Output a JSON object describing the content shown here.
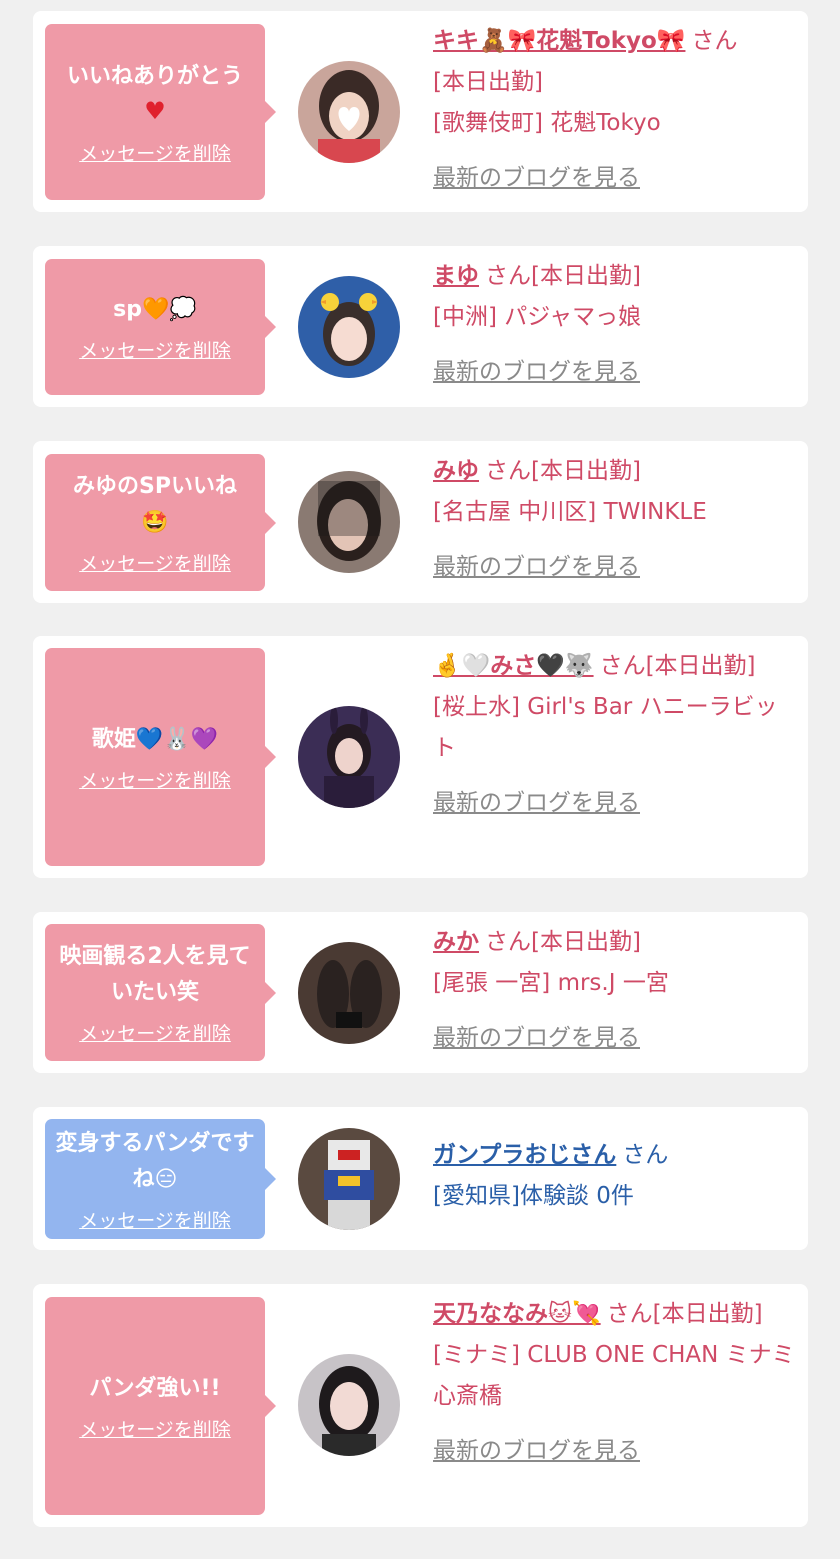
{
  "delete_label": "メッセージを削除",
  "blog_label": "最新のブログを見る",
  "colors": {
    "pink_bubble": "#ef9aa7",
    "blue_bubble": "#93b5ef",
    "name_pink": "#cf4a66",
    "name_blue": "#2a5fa8",
    "link_gray": "#8a8a8a"
  },
  "cards": [
    {
      "message": "いいねありがとう",
      "message_icon": "♥",
      "name": "キキ🧸🎀花魁Tokyo🎀",
      "san": "さん",
      "status": "[本日出勤]",
      "area": "[歌舞伎町] 花魁Tokyo",
      "avatar_icon": "girl-heart-face-photo"
    },
    {
      "message": "sp🧡💭",
      "name": "まゆ",
      "san": "さん[本日出勤]",
      "area": "[中洲] パジャマっ娘",
      "avatar_icon": "duck-ears-photo"
    },
    {
      "message": "みゆのSPいいね",
      "message_icon": "🤩",
      "name": "みゆ",
      "san": "さん[本日出勤]",
      "area": "[名古屋 中川区] TWINKLE",
      "avatar_icon": "veil-photo"
    },
    {
      "message": "歌姫💙🐰💜",
      "name": "🤞🤍みさ🖤🐺",
      "san": "さん[本日出勤]",
      "area": "[桜上水] Girl's Bar ハニーラビット",
      "avatar_icon": "bunny-photo"
    },
    {
      "message": "映画観る2人を見ていたい笑",
      "name": "みか",
      "san": "さん[本日出勤]",
      "area": "[尾張 一宮] mrs.J 一宮",
      "avatar_icon": "legs-photo"
    },
    {
      "message": "変身するパンダですね😑",
      "name": "ガンプラおじさん",
      "san": "さん",
      "area": "[愛知県]体験談 0件",
      "avatar_icon": "gundam-photo"
    },
    {
      "message": "パンダ強い!!",
      "name": "天乃ななみ🐱💘",
      "san": "さん[本日出勤]",
      "area": "[ミナミ] CLUB ONE CHAN ミナミ 心斎橋",
      "avatar_icon": "woman-portrait-photo"
    }
  ]
}
